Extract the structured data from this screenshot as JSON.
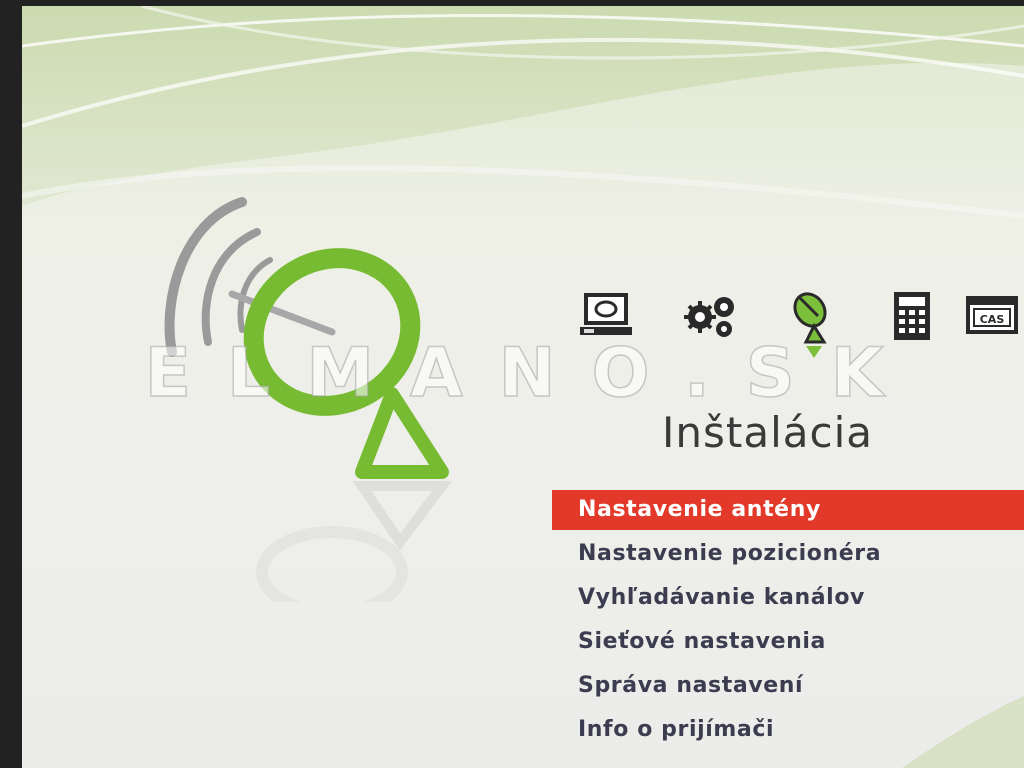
{
  "watermark": "ELMANO.SK",
  "title": "Inštalácia",
  "icons": [
    {
      "name": "tv-receiver-icon",
      "label": ""
    },
    {
      "name": "gears-icon",
      "label": ""
    },
    {
      "name": "satellite-dish-icon",
      "label": "",
      "active": true
    },
    {
      "name": "calculator-icon",
      "label": ""
    },
    {
      "name": "cas-card-icon",
      "label": "CAS"
    }
  ],
  "menu": {
    "items": [
      {
        "label": "Nastavenie antény",
        "selected": true
      },
      {
        "label": "Nastavenie pozicionéra"
      },
      {
        "label": "Vyhľadávanie kanálov"
      },
      {
        "label": "Sieťové nastavenia"
      },
      {
        "label": "Správa nastavení"
      },
      {
        "label": "Info o prijímači"
      }
    ]
  },
  "colors": {
    "accent_green": "#7bbf3a",
    "selection_red": "#e2392a",
    "text_dark": "#3c3c50"
  }
}
